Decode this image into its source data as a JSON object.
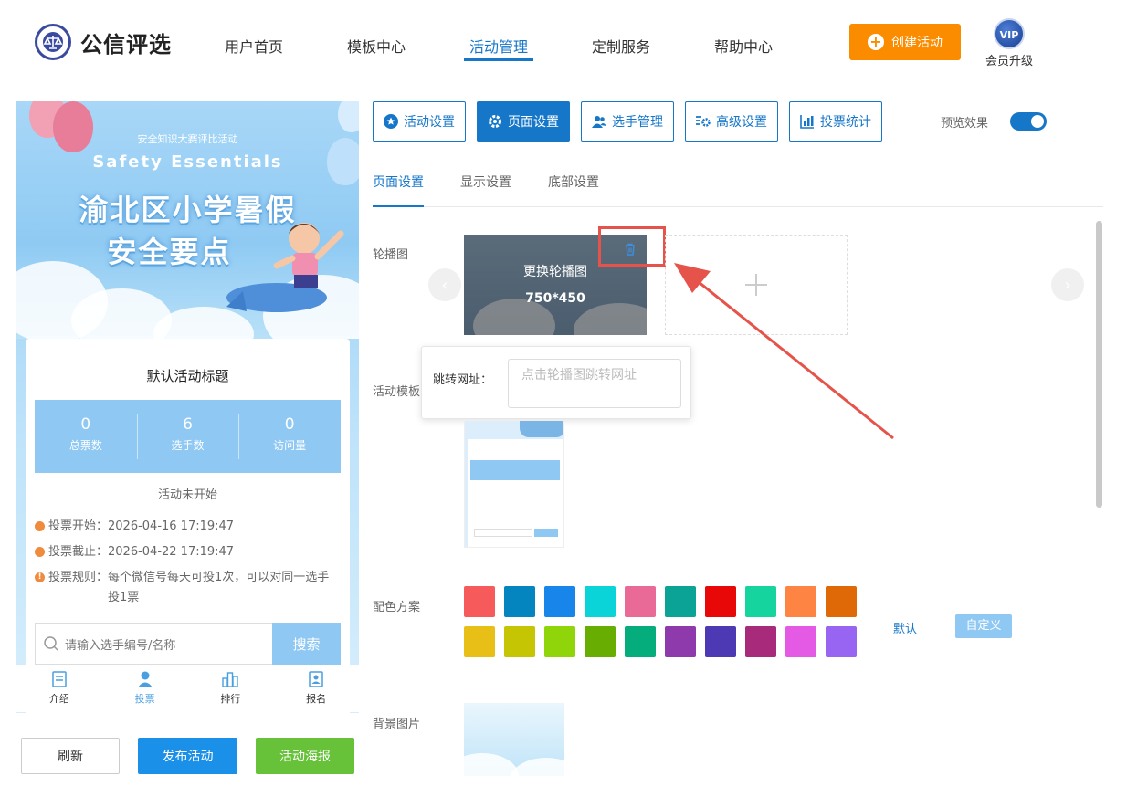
{
  "header": {
    "brand": "公信评选",
    "nav": [
      "用户首页",
      "模板中心",
      "活动管理",
      "定制服务",
      "帮助中心"
    ],
    "active_nav": "活动管理",
    "create_button": "创建活动",
    "vip_badge": "VIP",
    "vip_label": "会员升级"
  },
  "preview": {
    "banner": {
      "subtitle": "安全知识大赛评比活动",
      "english": "Safety  Essentials",
      "title_line1": "渝北区小学暑假",
      "title_line2": "安全要点"
    },
    "card_title": "默认活动标题",
    "stats": [
      {
        "value": "0",
        "label": "总票数"
      },
      {
        "value": "6",
        "label": "选手数"
      },
      {
        "value": "0",
        "label": "访问量"
      }
    ],
    "status": "活动未开始",
    "vote_start": "投票开始：2026-04-16 17:19:47",
    "vote_end": "投票截止：2026-04-22 17:19:47",
    "rules_prefix": "投票规则：",
    "rules_line1": "每个微信号每天可投1次，可以对同一选手",
    "rules_line2": "投1票",
    "search_placeholder": "请输入选手编号/名称",
    "search_button": "搜索",
    "tabs": [
      "介绍",
      "投票",
      "排行",
      "报名"
    ]
  },
  "bottom_buttons": {
    "refresh": "刷新",
    "publish": "发布活动",
    "poster": "活动海报"
  },
  "toolbar": {
    "buttons": [
      "活动设置",
      "页面设置",
      "选手管理",
      "高级设置",
      "投票统计"
    ],
    "active": "页面设置",
    "preview_label": "预览效果",
    "preview_on": true
  },
  "subtabs": {
    "items": [
      "页面设置",
      "显示设置",
      "底部设置"
    ],
    "active": "页面设置"
  },
  "form": {
    "carousel_label": "轮播图",
    "carousel_overlay_text": "更换轮播图",
    "carousel_size": "750*450",
    "jump_url_label": "跳转网址：",
    "jump_url_placeholder": "点击轮播图跳转网址",
    "template_label": "活动模板",
    "color_label": "配色方案",
    "color_default": "默认",
    "color_custom": "自定义",
    "bg_label": "背景图片"
  },
  "colors": {
    "primary": "#1677c9",
    "orange": "#fb8c00",
    "green": "#67c23a",
    "publish_blue": "#1a90e8",
    "swatches": [
      "#f65a5b",
      "#0585c0",
      "#1785ea",
      "#0ad4d8",
      "#e96a96",
      "#0aa395",
      "#e80808",
      "#16d49e",
      "#fd8442",
      "#df6807",
      "#e8bf16",
      "#c5c504",
      "#8fd50a",
      "#67ad02",
      "#04ad7b",
      "#8e3aad",
      "#4e39b4",
      "#a82a7b",
      "#e45ae4",
      "#9765f2"
    ]
  }
}
